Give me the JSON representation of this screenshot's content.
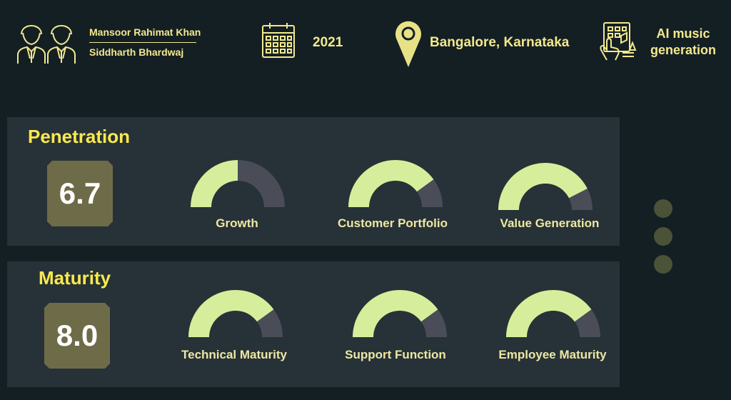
{
  "header": {
    "founders": [
      "Mansoor Rahimat Khan",
      "Siddharth Bhardwaj"
    ],
    "year": "2021",
    "location": "Bangalore, Karnataka",
    "domain_line1": "AI music",
    "domain_line2": "generation"
  },
  "sections": [
    {
      "title": "Penetration",
      "score": "6.7",
      "gauges": [
        {
          "label": "Growth",
          "value": 0.5
        },
        {
          "label": "Customer Portfolio",
          "value": 0.8
        },
        {
          "label": "Value Generation",
          "value": 0.85
        }
      ]
    },
    {
      "title": "Maturity",
      "score": "8.0",
      "gauges": [
        {
          "label": "Technical Maturity",
          "value": 0.8
        },
        {
          "label": "Support Function",
          "value": 0.8
        },
        {
          "label": "Employee Maturity",
          "value": 0.8
        }
      ]
    }
  ],
  "colors": {
    "gauge_fill": "#d6ee9b",
    "gauge_track": "#4a4d57",
    "accent": "#f2e98c",
    "title": "#fbe94d",
    "panel": "#263237",
    "background": "#141f24"
  },
  "icons": [
    "founders-icon",
    "calendar-icon",
    "location-pin-icon",
    "ai-music-icon"
  ]
}
